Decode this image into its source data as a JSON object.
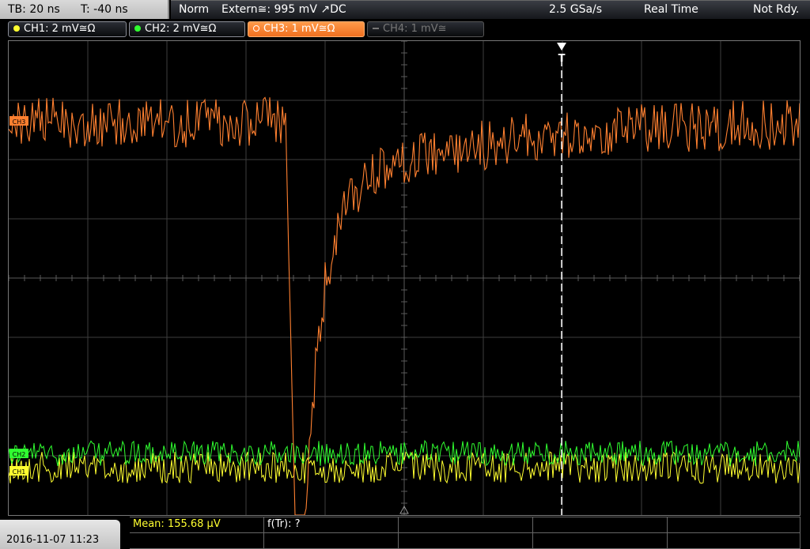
{
  "status": {
    "timebase": "TB: 20 ns",
    "trigger_offset": "T: -40 ns",
    "trigger_mode": "Norm",
    "trigger_source": "Extern≅: 995 mV ↗DC",
    "sample_rate": "2.5 GSa/s",
    "acq_mode": "Real Time",
    "state": "Not Rdy."
  },
  "channels": [
    {
      "label": "CH1: 2 mV≅Ω",
      "color": "#ffff30",
      "state": "on"
    },
    {
      "label": "CH2: 2 mV≅Ω",
      "color": "#30ff30",
      "state": "on"
    },
    {
      "label": "CH3: 1 mV≅Ω",
      "color": "#ff8030",
      "state": "active"
    },
    {
      "label": "CH4: 1 mV≅",
      "color": "#777777",
      "state": "off"
    }
  ],
  "markers": {
    "trigger": "T",
    "ch3": "CH3",
    "ch2": "CH2",
    "ch1": "CH1"
  },
  "measurements": {
    "mean": "Mean: 155.68 µV",
    "risetime": "f(Tr): ?"
  },
  "datetime": "2016-11-07 11:23",
  "colors": {
    "ch1": "#ffff30",
    "ch2": "#30ff30",
    "ch3": "#ff8030",
    "grid": "#404040"
  }
}
